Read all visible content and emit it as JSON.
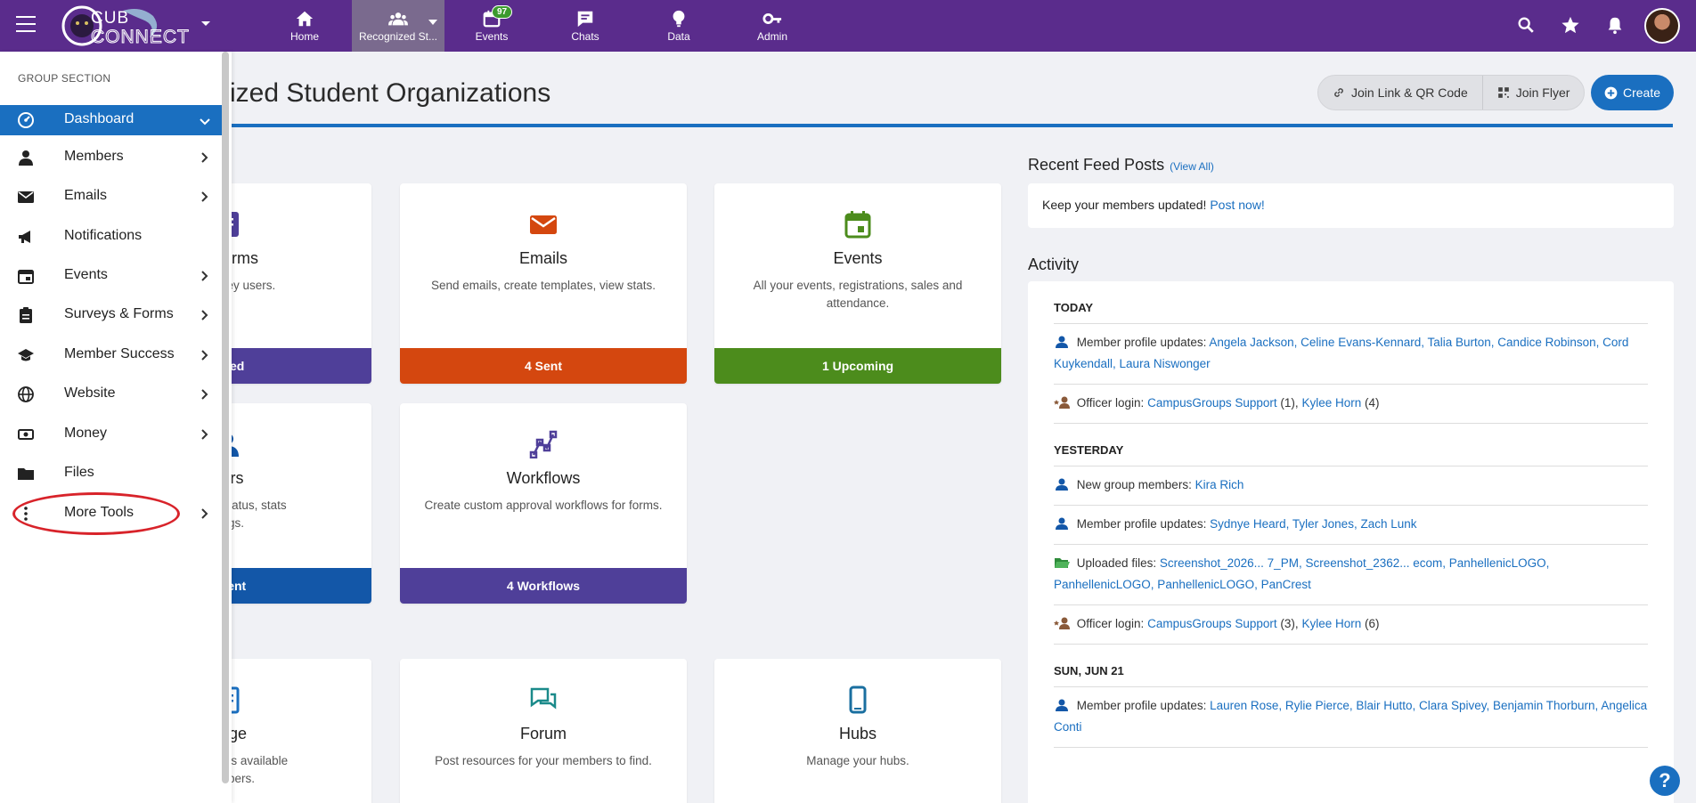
{
  "topbar": {
    "logo_text": "CUB CONNECT",
    "nav": [
      {
        "label": "Home",
        "icon": "home-icon"
      },
      {
        "label": "Recognized St...",
        "icon": "group-icon"
      },
      {
        "label": "Events",
        "icon": "calendar-icon",
        "badge": "97"
      },
      {
        "label": "Chats",
        "icon": "chat-icon"
      },
      {
        "label": "Data",
        "icon": "lightbulb-icon"
      },
      {
        "label": "Admin",
        "icon": "key-icon"
      }
    ],
    "colors": {
      "bar": "#5a2c8c",
      "accent": "#1a6fc0"
    }
  },
  "page": {
    "title": "ized Student Organizations",
    "join_link_label": "Join Link & QR Code",
    "join_flyer_label": "Join Flyer",
    "create_label": "Create"
  },
  "cards": [
    {
      "title": "& Forms",
      "desc": "and survey users.",
      "footer": "eated",
      "color": "#4f3f99",
      "icon": "form-icon"
    },
    {
      "title": "Emails",
      "desc": "Send emails, create templates, view stats.",
      "footer": "4 Sent",
      "color": "#d4470f",
      "icon": "envelope-icon"
    },
    {
      "title": "Events",
      "desc": "All your events, registrations, sales and attendance.",
      "footer": "1 Upcoming",
      "color": "#4c8c1c",
      "icon": "calendar-icon"
    },
    {
      "title": "bers",
      "desc": "mbership status, stats\nttings.",
      "footer": "urrent",
      "color": "#1357a8",
      "icon": "member-icon"
    },
    {
      "title": "Workflows",
      "desc": "Create custom approval workflows for forms.",
      "footer": "4 Workflows",
      "color": "#4f3f99",
      "icon": "workflow-icon"
    },
    {
      "title": "Page",
      "desc": "ke resources available\nmembers.",
      "icon": "page-icon"
    },
    {
      "title": "Forum",
      "desc": "Post resources for your members to find.",
      "icon": "forum-icon"
    },
    {
      "title": "Hubs",
      "desc": "Manage your hubs.",
      "icon": "mobile-icon"
    }
  ],
  "feed": {
    "heading": "Recent Feed Posts",
    "view_all": "(View All)",
    "prompt": "Keep your members updated!",
    "post_now": "Post now!"
  },
  "activity": {
    "heading": "Activity",
    "today": "TODAY",
    "yesterday": "YESTERDAY",
    "sun": "SUN, JUN 21",
    "r1_label": "Member profile updates:",
    "r1_links": "Angela Jackson, Celine Evans-Kennard, Talia Burton, Candice Robinson, Cord Kuykendall, Laura Niswonger",
    "r2_label": "Officer login:",
    "r2_link1": "CampusGroups Support",
    "r2_count1": "(1),",
    "r2_link2": "Kylee Horn",
    "r2_count2": "(4)",
    "r3_label": "New group members:",
    "r3_links": "Kira Rich",
    "r4_label": "Member profile updates:",
    "r4_links": "Sydnye Heard, Tyler Jones, Zach Lunk",
    "r5_label": "Uploaded files:",
    "r5_links": "Screenshot_2026... 7_PM, Screenshot_2362... ecom, PanhellenicLOGO, PanhellenicLOGO, PanhellenicLOGO, PanCrest",
    "r6_label": "Officer login:",
    "r6_link1": "CampusGroups Support",
    "r6_count1": "(3),",
    "r6_link2": "Kylee Horn",
    "r6_count2": "(6)",
    "r7_label": "Member profile updates:",
    "r7_links": "Lauren Rose, Rylie Pierce, Blair Hutto, Clara Spivey, Benjamin Thorburn, Angelica Conti"
  },
  "sidebar": {
    "section": "GROUP SECTION",
    "items": [
      {
        "label": "Dashboard",
        "icon": "dashboard-icon"
      },
      {
        "label": "Members",
        "icon": "person-icon"
      },
      {
        "label": "Emails",
        "icon": "envelope-icon"
      },
      {
        "label": "Notifications",
        "icon": "megaphone-icon"
      },
      {
        "label": "Events",
        "icon": "calendar-icon"
      },
      {
        "label": "Surveys & Forms",
        "icon": "clipboard-icon"
      },
      {
        "label": "Member Success",
        "icon": "graduation-cap-icon"
      },
      {
        "label": "Website",
        "icon": "globe-icon"
      },
      {
        "label": "Money",
        "icon": "money-icon"
      },
      {
        "label": "Files",
        "icon": "folder-icon"
      },
      {
        "label": "More Tools",
        "icon": "kebab-icon"
      }
    ]
  },
  "help": "?"
}
